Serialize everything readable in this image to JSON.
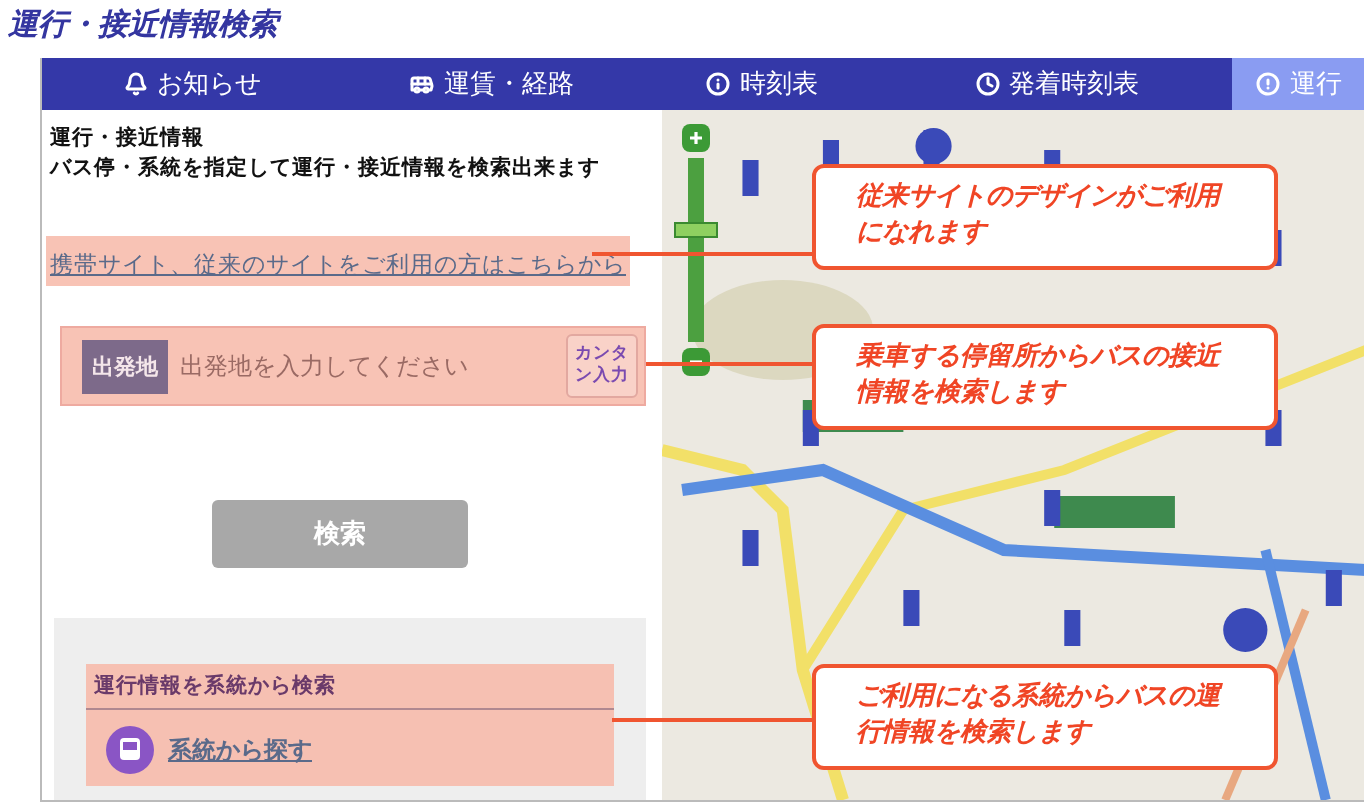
{
  "page_title": "運行・接近情報検索",
  "tabs": [
    {
      "label": "お知らせ",
      "selected": false
    },
    {
      "label": "運賃・経路",
      "selected": false
    },
    {
      "label": "時刻表",
      "selected": false
    },
    {
      "label": "発着時刻表",
      "selected": false
    },
    {
      "label": "運行",
      "selected": true
    }
  ],
  "info": {
    "heading": "運行・接近情報",
    "description": "バス停・系統を指定して運行・接近情報を検索出来ます"
  },
  "legacy_link": "携帯サイト、従来のサイトをご利用の方はこちらから",
  "departure": {
    "label": "出発地",
    "placeholder": "出発地を入力してください",
    "easy_input_button": "カンタン入力"
  },
  "search_button": {
    "label": "検索",
    "disabled": true
  },
  "route_search": {
    "heading": "運行情報を系統から検索",
    "link": "系統から探す"
  },
  "map": {
    "kind": "picture",
    "zoom_slider": {
      "level": 0.62
    }
  },
  "callouts": [
    "従来サイトのデザインがご利用になれます",
    "乗車する停留所からバスの接近情報を検索します",
    "ご利用になる系統からバスの運行情報を検索します"
  ]
}
